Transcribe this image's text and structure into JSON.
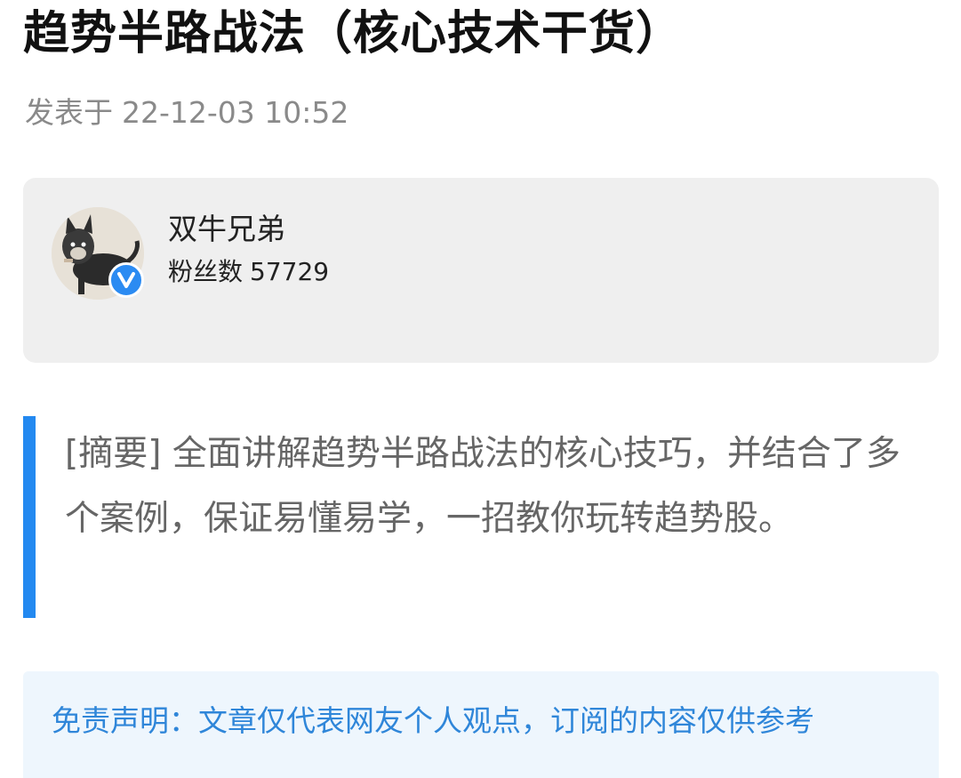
{
  "article": {
    "title": "趋势半路战法（核心技术干货）",
    "published_prefix": "发表于",
    "published_at": "22-12-03 10:52"
  },
  "author": {
    "name": "双牛兄弟",
    "fans_label": "粉丝数",
    "fans_count": "57729",
    "verified_icon": "verified-v-icon",
    "verified_symbol": "V"
  },
  "summary": {
    "text": "[摘要] 全面讲解趋势半路战法的核心技巧，并结合了多个案例，保证易懂易学，一招教你玩转趋势股。"
  },
  "disclaimer": {
    "text": "免责声明：文章仅代表网友个人观点，订阅的内容仅供参考"
  },
  "colors": {
    "accent": "#2389f0",
    "disclaimer_text": "#2f86d9",
    "card_bg": "#efefef",
    "meta_text": "#8a8a8a"
  }
}
